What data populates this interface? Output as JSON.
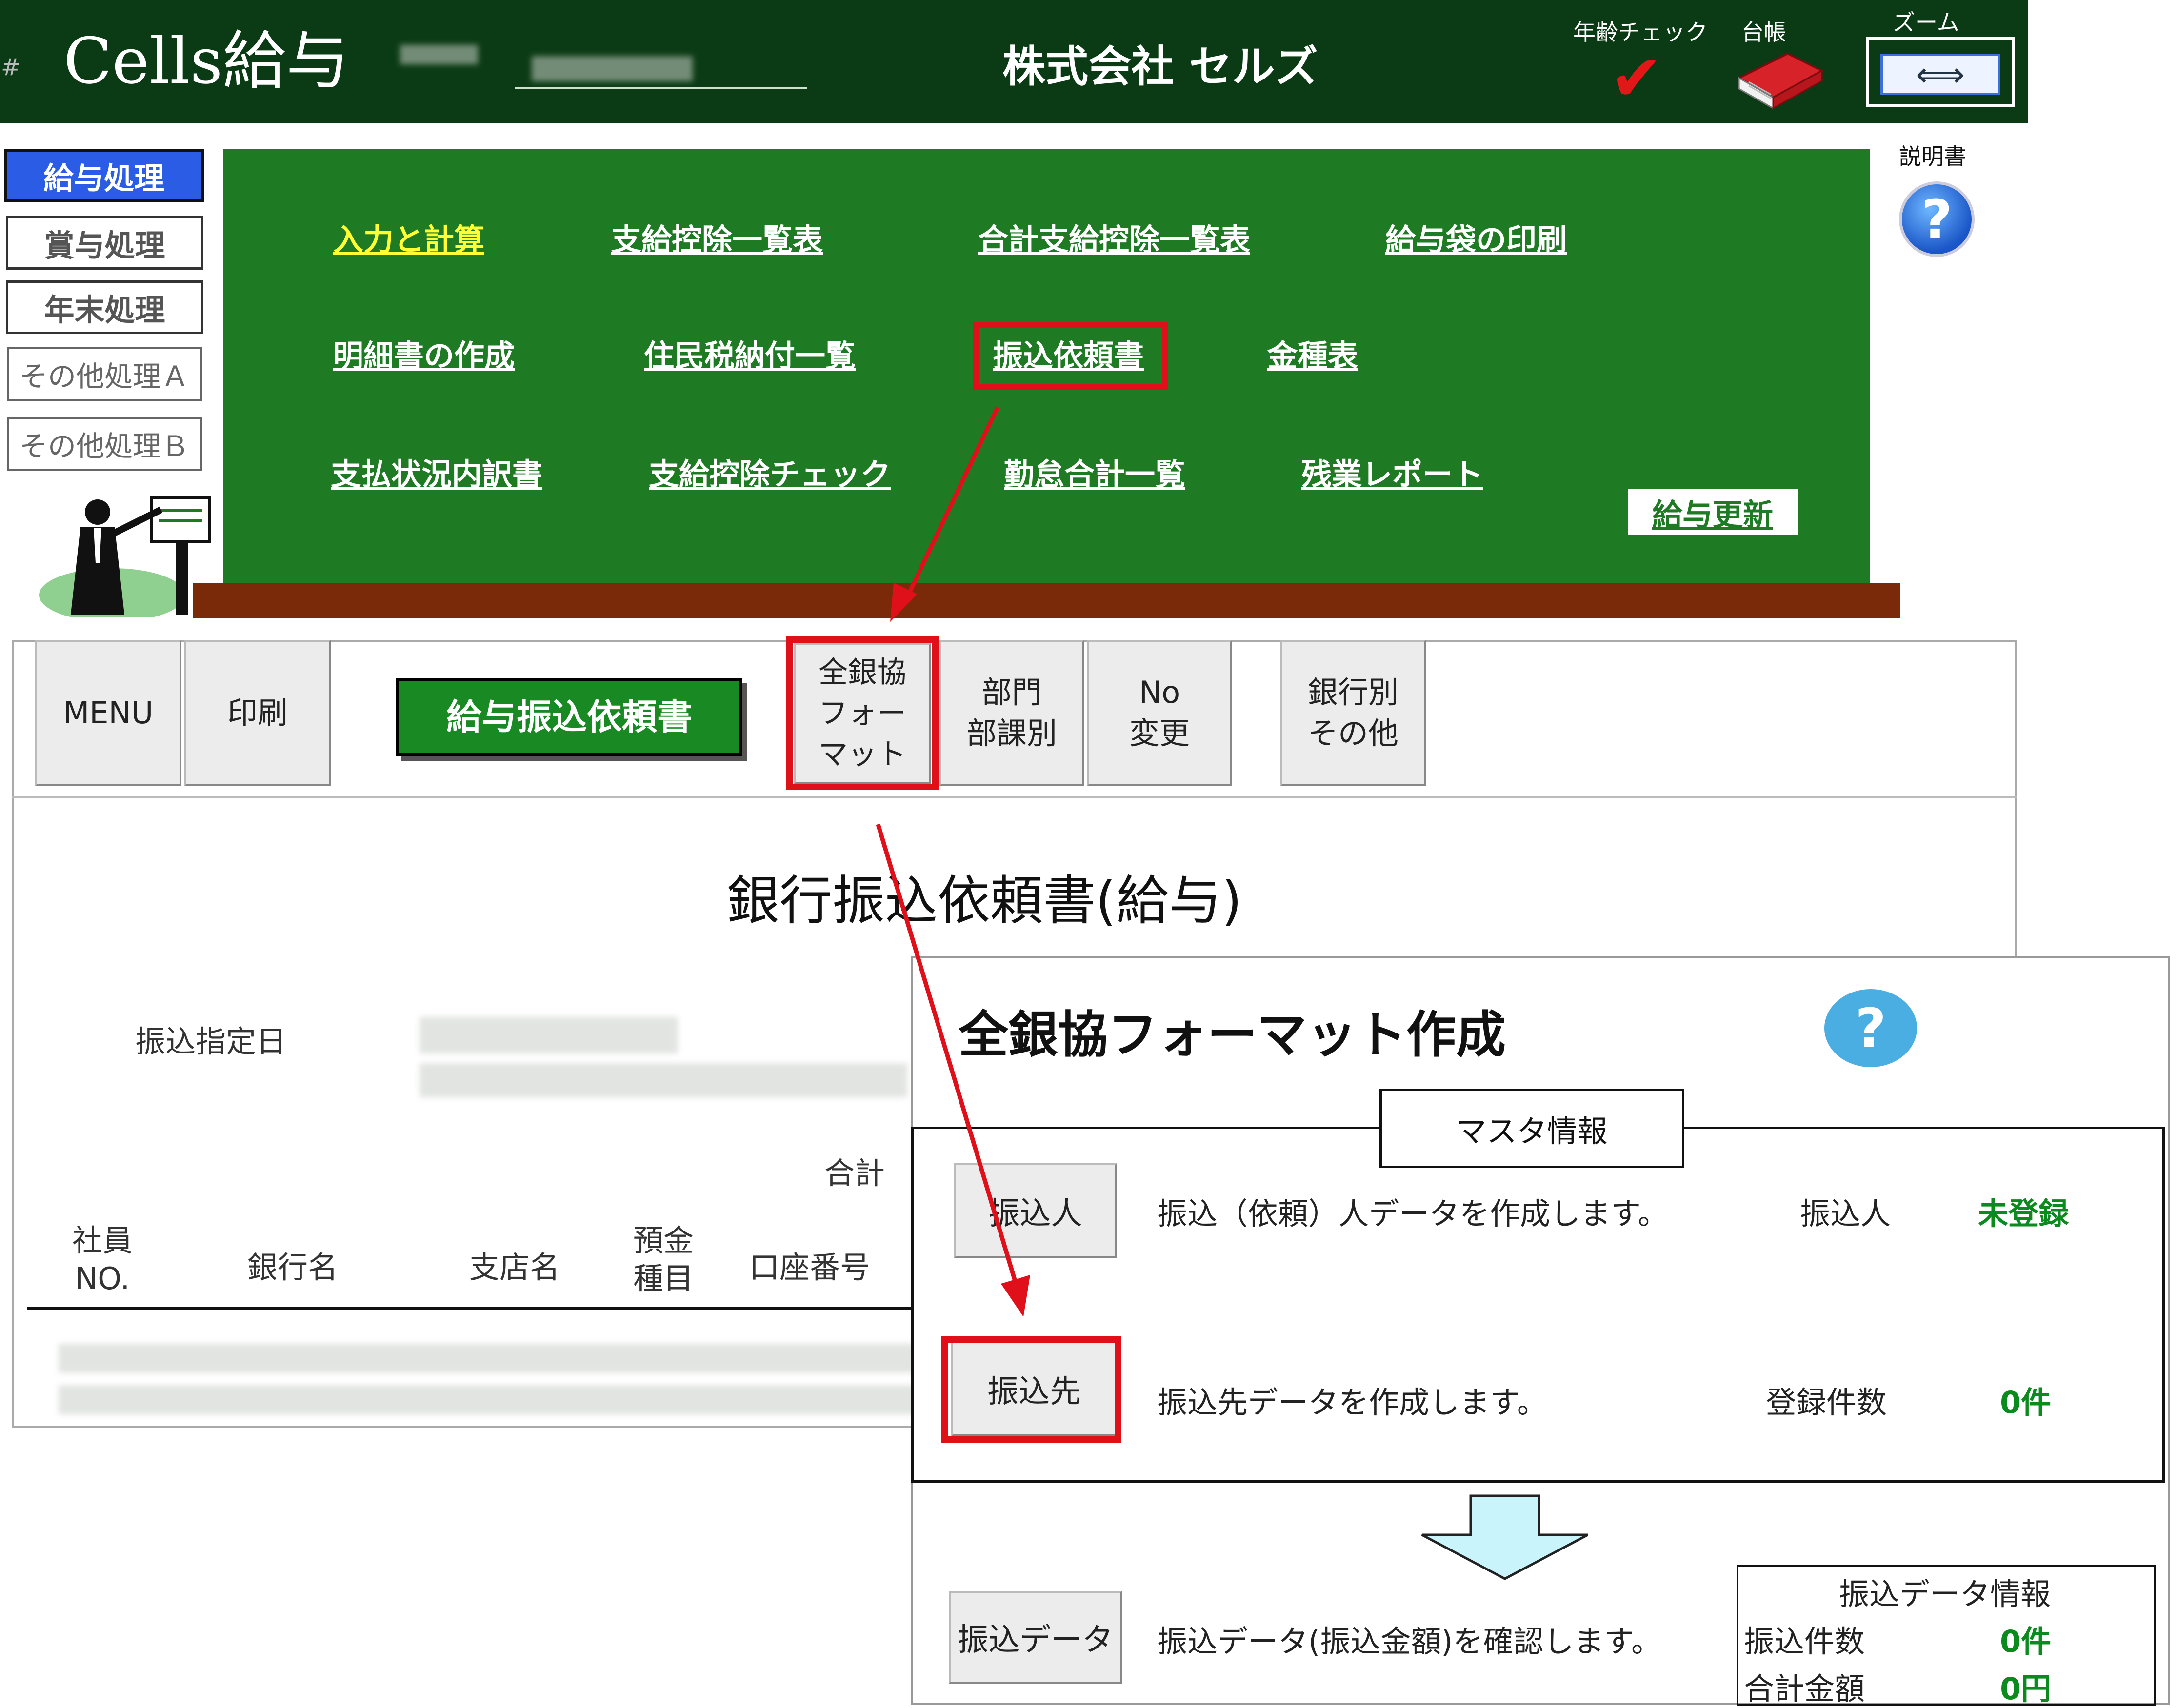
{
  "header": {
    "hash": "#",
    "app_title": "Cells給与",
    "company": "株式会社 セルズ",
    "age_check_label": "年齢チェック",
    "ledger_label": "台帳",
    "zoom_label": "ズーム",
    "zoom_glyph": "⟺"
  },
  "sidebar": {
    "items": [
      {
        "label": "給与処理"
      },
      {
        "label": "賞与処理"
      },
      {
        "label": "年末処理"
      },
      {
        "label": "その他処理Ａ"
      },
      {
        "label": "その他処理Ｂ"
      }
    ]
  },
  "board": {
    "links": [
      "入力と計算",
      "支給控除一覧表",
      "合計支給控除一覧表",
      "給与袋の印刷",
      "明細書の作成",
      "住民税納付一覧",
      "振込依頼書",
      "金種表",
      "支払状況内訳書",
      "支給控除チェック",
      "勤怠合計一覧",
      "残業レポート"
    ],
    "update_label": "給与更新",
    "manual_label": "説明書",
    "manual_icon": "?"
  },
  "toolbar": {
    "menu": "MENU",
    "print": "印刷",
    "salary_transfer": "給与振込依頼書",
    "zengin": "全銀協\nフォー\nマット",
    "dept": "部門\n部課別",
    "no_change": "No\n変更",
    "bank": "銀行別\nその他"
  },
  "document": {
    "title": "銀行振込依頼書(給与)",
    "designated_date_label": "振込指定日",
    "total_label": "合計",
    "columns": [
      "社員\nNO.",
      "銀行名",
      "支店名",
      "預金\n種目",
      "口座番号"
    ]
  },
  "dialog": {
    "title": "全銀協フォーマット作成",
    "help_icon": "?",
    "master_title": "マスタ情報",
    "transferor_button": "振込人",
    "transferor_text": "振込（依頼）人データを作成します。",
    "transferor_label": "振込人",
    "transferor_status": "未登録",
    "destination_button": "振込先",
    "destination_text": "振込先データを作成します。",
    "count_label": "登録件数",
    "count_value": "0件",
    "data_button": "振込データ",
    "data_text": "振込データ(振込金額)を確認します。",
    "info": {
      "title": "振込データ情報",
      "count_label": "振込件数",
      "count_value": "0件",
      "amount_label": "合計金額",
      "amount_value": "0円"
    }
  },
  "colors": {
    "header_bg": "#0b3b14",
    "board_bg": "#1e7a23",
    "highlight": "#e0101a",
    "status_green": "#0b8a1e"
  }
}
